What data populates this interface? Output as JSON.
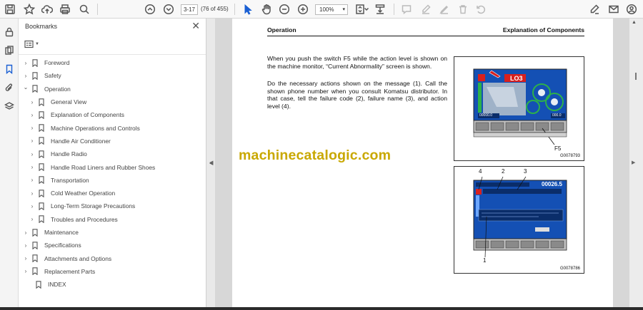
{
  "toolbar": {
    "page_current": "3-17",
    "page_count": "(76 of 455)",
    "zoom": "100%"
  },
  "bookmarks": {
    "title": "Bookmarks",
    "items": [
      {
        "label": "Foreword",
        "level": 0,
        "state": "collapsed"
      },
      {
        "label": "Safety",
        "level": 0,
        "state": "collapsed"
      },
      {
        "label": "Operation",
        "level": 0,
        "state": "expanded"
      },
      {
        "label": "General View",
        "level": 1,
        "state": "collapsed"
      },
      {
        "label": "Explanation of Components",
        "level": 1,
        "state": "collapsed"
      },
      {
        "label": "Machine Operations and Controls",
        "level": 1,
        "state": "collapsed"
      },
      {
        "label": "Handle Air Conditioner",
        "level": 1,
        "state": "collapsed"
      },
      {
        "label": "Handle Radio",
        "level": 1,
        "state": "collapsed"
      },
      {
        "label": "Handle Road Liners and Rubber Shoes",
        "level": 1,
        "state": "collapsed"
      },
      {
        "label": "Transportation",
        "level": 1,
        "state": "collapsed"
      },
      {
        "label": "Cold Weather Operation",
        "level": 1,
        "state": "collapsed"
      },
      {
        "label": "Long-Term Storage Precautions",
        "level": 1,
        "state": "collapsed"
      },
      {
        "label": "Troubles and Procedures",
        "level": 1,
        "state": "collapsed"
      },
      {
        "label": "Maintenance",
        "level": 0,
        "state": "collapsed"
      },
      {
        "label": "Specifications",
        "level": 0,
        "state": "collapsed"
      },
      {
        "label": "Attachments and Options",
        "level": 0,
        "state": "collapsed"
      },
      {
        "label": "Replacement Parts",
        "level": 0,
        "state": "collapsed"
      },
      {
        "label": "INDEX",
        "level": 0,
        "state": "none"
      }
    ]
  },
  "document": {
    "header_left": "Operation",
    "header_right": "Explanation of Components",
    "para1": "When you push the switch F5 while the action level is shown on the machine monitor, “Current Abnormality” screen is shown.",
    "para2": "Do the necessary actions shown on the message (1). Call the shown phone number when you consult Komatsu distributor. In that case, tell the failure code (2), failure name (3), and action level (4).",
    "watermark": "machinecatalogic.com",
    "figure1": {
      "code": "G0078793",
      "callout": "F5",
      "screen_label": "LO3",
      "readout_left": "00000.0",
      "readout_right": "000.0"
    },
    "figure2": {
      "code": "G0078786",
      "callouts": [
        "4",
        "2",
        "3",
        "1"
      ],
      "hour_meter": "00026.5"
    }
  },
  "colors": {
    "accent": "#1a5fd3",
    "monitor_bg": "#1450b4",
    "alert_red": "#d8201e",
    "watermark": "#c9a800"
  }
}
